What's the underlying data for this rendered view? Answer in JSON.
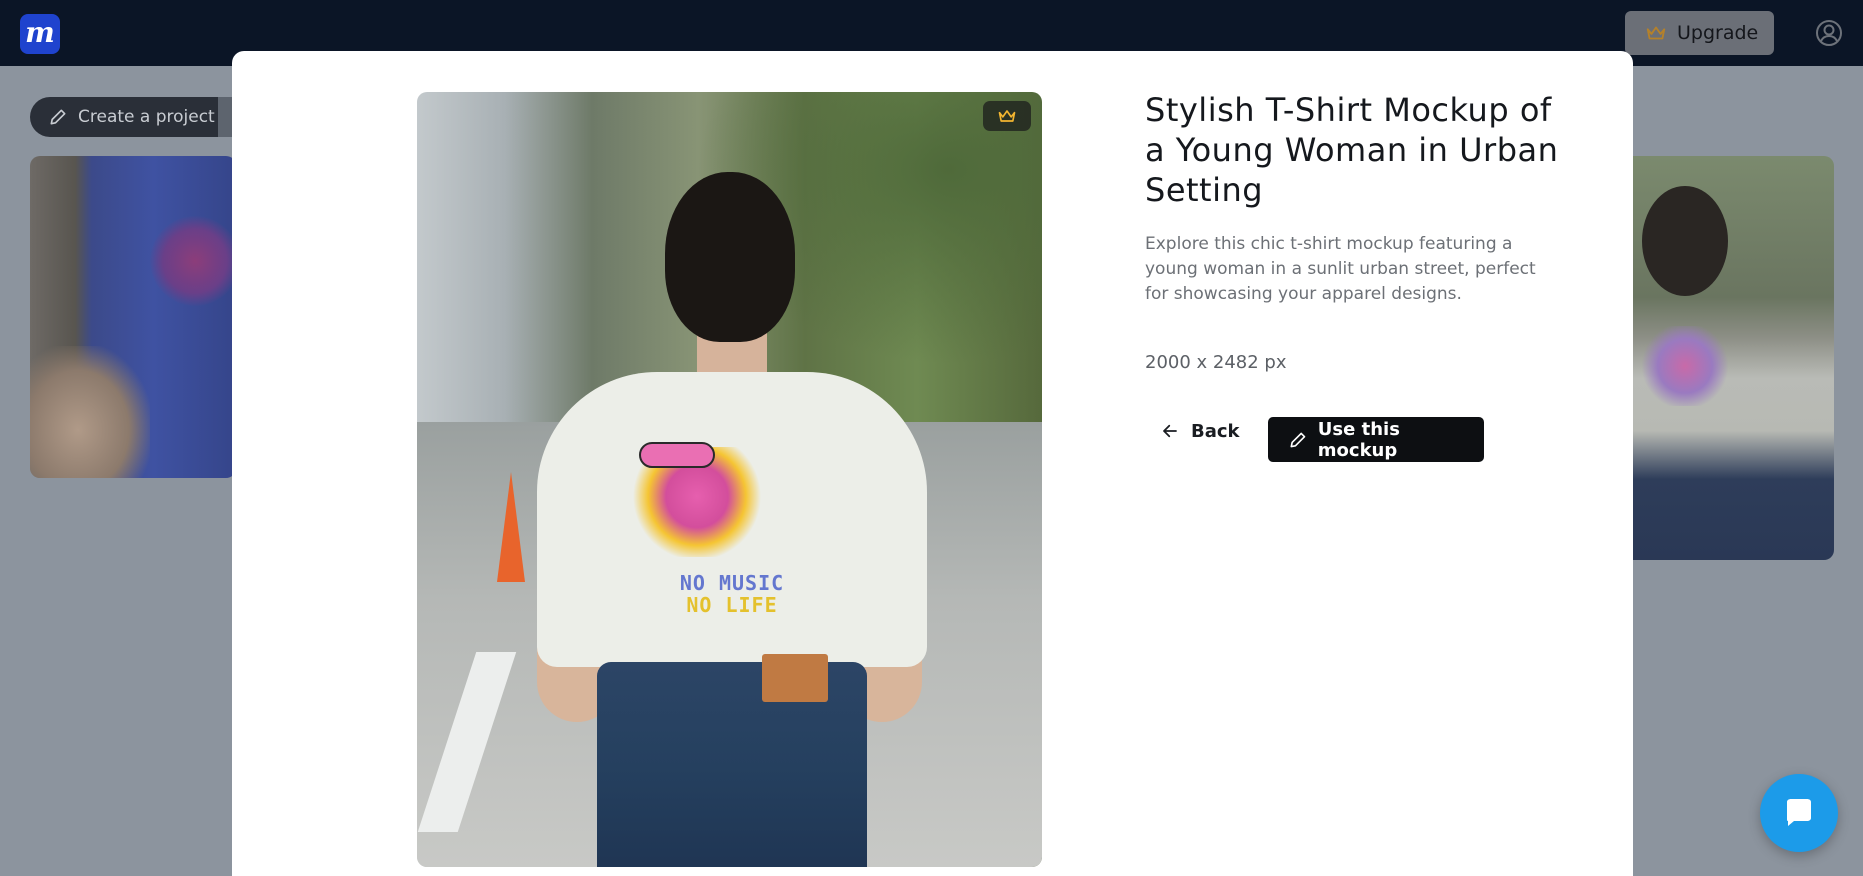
{
  "topbar": {
    "logo_letter": "m",
    "upgrade_label": "Upgrade"
  },
  "background": {
    "create_project_label": "Create a project"
  },
  "modal": {
    "title": "Stylish T-Shirt Mockup of a Young Woman in Urban Setting",
    "description": "Explore this chic t-shirt mockup featuring a young woman in a sunlit urban street, perfect for showcasing your apparel designs.",
    "dimensions": "2000 x 2482 px",
    "back_label": "Back",
    "use_label": "Use this mockup",
    "image_print": {
      "line1": "NO MUSIC",
      "line2": "NO LIFE"
    }
  },
  "colors": {
    "topbar_bg": "#0b1526",
    "logo_bg": "#1f43ce",
    "premium_crown": "#f2b530",
    "primary_button": "#0d0f12",
    "chat_fab": "#1c9be9"
  },
  "icons": {
    "upgrade": "crown-icon",
    "account": "user-circle-icon",
    "create_project": "pencil-icon",
    "premium_badge": "crown-icon",
    "back": "arrow-left-icon",
    "use_mockup": "pencil-icon",
    "chat": "chat-bubble-icon"
  }
}
